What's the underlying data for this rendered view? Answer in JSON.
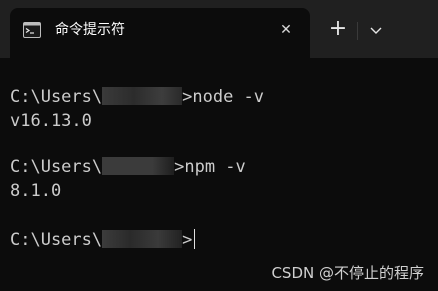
{
  "tab": {
    "title": "命令提示符",
    "icon": "cmd-icon",
    "close_label": "✕"
  },
  "controls": {
    "new_tab_label": "+",
    "dropdown_icon": "chevron-down-icon"
  },
  "terminal": {
    "lines": [
      {
        "prefix": "C:\\Users\\",
        "suffix": ">node -v"
      },
      {
        "text": "v16.13.0"
      },
      {
        "prefix": "C:\\Users\\",
        "suffix": ">npm -v"
      },
      {
        "text": "8.1.0"
      },
      {
        "prefix": "C:\\Users\\",
        "suffix": ">"
      }
    ]
  },
  "watermark": "CSDN @不停止的程序",
  "colors": {
    "background": "#0c0c0c",
    "titlebar": "#202020",
    "text": "#cccccc"
  }
}
